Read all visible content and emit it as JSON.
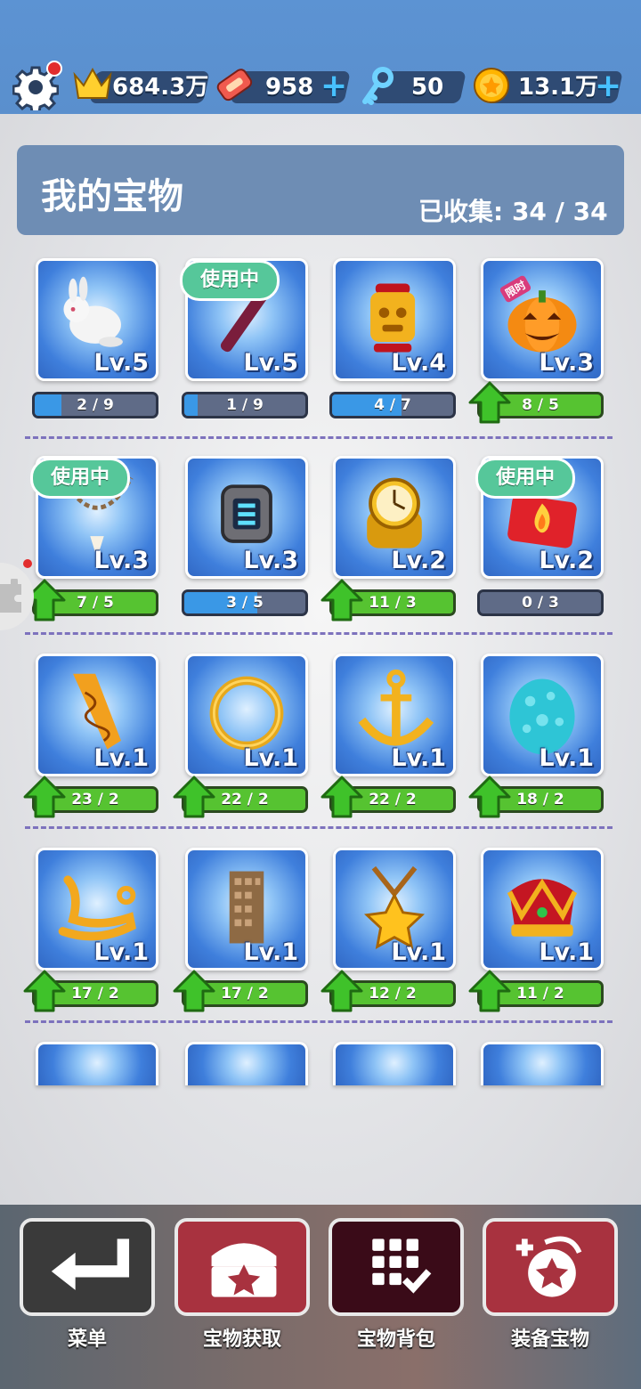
{
  "topbar": {
    "crown_value": "684.3万",
    "ticket_value": "958",
    "key_value": "50",
    "coin_value": "13.1万",
    "plus_symbol": "+",
    "settings_has_notification": true
  },
  "header": {
    "title": "我的宝物",
    "collected_label": "已收集: 34 / 34"
  },
  "items": [
    {
      "name": "rabbit",
      "level": "Lv.5",
      "progress": "2 / 9",
      "fill": 0.22,
      "upgrade": false,
      "in_use": false
    },
    {
      "name": "magic-wand",
      "level": "Lv.5",
      "progress": "1 / 9",
      "fill": 0.11,
      "upgrade": false,
      "in_use": true
    },
    {
      "name": "golden-idol",
      "level": "Lv.4",
      "progress": "4 / 7",
      "fill": 0.57,
      "upgrade": false,
      "in_use": false
    },
    {
      "name": "pumpkin",
      "level": "Lv.3",
      "progress": "8 / 5",
      "fill": 1,
      "upgrade": true,
      "in_use": false,
      "tag": "限时"
    },
    {
      "name": "tooth-necklace",
      "level": "Lv.3",
      "progress": "7 / 5",
      "fill": 1,
      "upgrade": true,
      "in_use": true
    },
    {
      "name": "smart-watch",
      "level": "Lv.3",
      "progress": "3 / 5",
      "fill": 0.6,
      "upgrade": false,
      "in_use": false
    },
    {
      "name": "gold-watch",
      "level": "Lv.2",
      "progress": "11 / 3",
      "fill": 1,
      "upgrade": true,
      "in_use": false
    },
    {
      "name": "fire-bag",
      "level": "Lv.2",
      "progress": "0 / 3",
      "fill": 0,
      "upgrade": false,
      "in_use": true
    },
    {
      "name": "golden-scroll",
      "level": "Lv.1",
      "progress": "23 / 2",
      "fill": 1,
      "upgrade": true,
      "in_use": false
    },
    {
      "name": "golden-ring",
      "level": "Lv.1",
      "progress": "22 / 2",
      "fill": 1,
      "upgrade": true,
      "in_use": false
    },
    {
      "name": "anchor",
      "level": "Lv.1",
      "progress": "22 / 2",
      "fill": 1,
      "upgrade": true,
      "in_use": false
    },
    {
      "name": "spotted-egg",
      "level": "Lv.1",
      "progress": "18 / 2",
      "fill": 1,
      "upgrade": true,
      "in_use": false
    },
    {
      "name": "golden-horn",
      "level": "Lv.1",
      "progress": "17 / 2",
      "fill": 1,
      "upgrade": true,
      "in_use": false
    },
    {
      "name": "skyscraper",
      "level": "Lv.1",
      "progress": "17 / 2",
      "fill": 1,
      "upgrade": true,
      "in_use": false
    },
    {
      "name": "star-medal",
      "level": "Lv.1",
      "progress": "12 / 2",
      "fill": 1,
      "upgrade": true,
      "in_use": false
    },
    {
      "name": "crown",
      "level": "Lv.1",
      "progress": "11 / 2",
      "fill": 1,
      "upgrade": true,
      "in_use": false
    }
  ],
  "in_use_label": "使用中",
  "bottom_nav": [
    {
      "key": "menu",
      "label": "菜单",
      "color": "#3a3a3a",
      "icon": "return-arrow-icon"
    },
    {
      "key": "get",
      "label": "宝物获取",
      "color": "#a8323f",
      "icon": "treasure-chest-icon"
    },
    {
      "key": "bag",
      "label": "宝物背包",
      "color": "#3a0b18",
      "icon": "grid-check-icon"
    },
    {
      "key": "equip",
      "label": "装备宝物",
      "color": "#a8323f",
      "icon": "equip-medal-icon"
    }
  ]
}
